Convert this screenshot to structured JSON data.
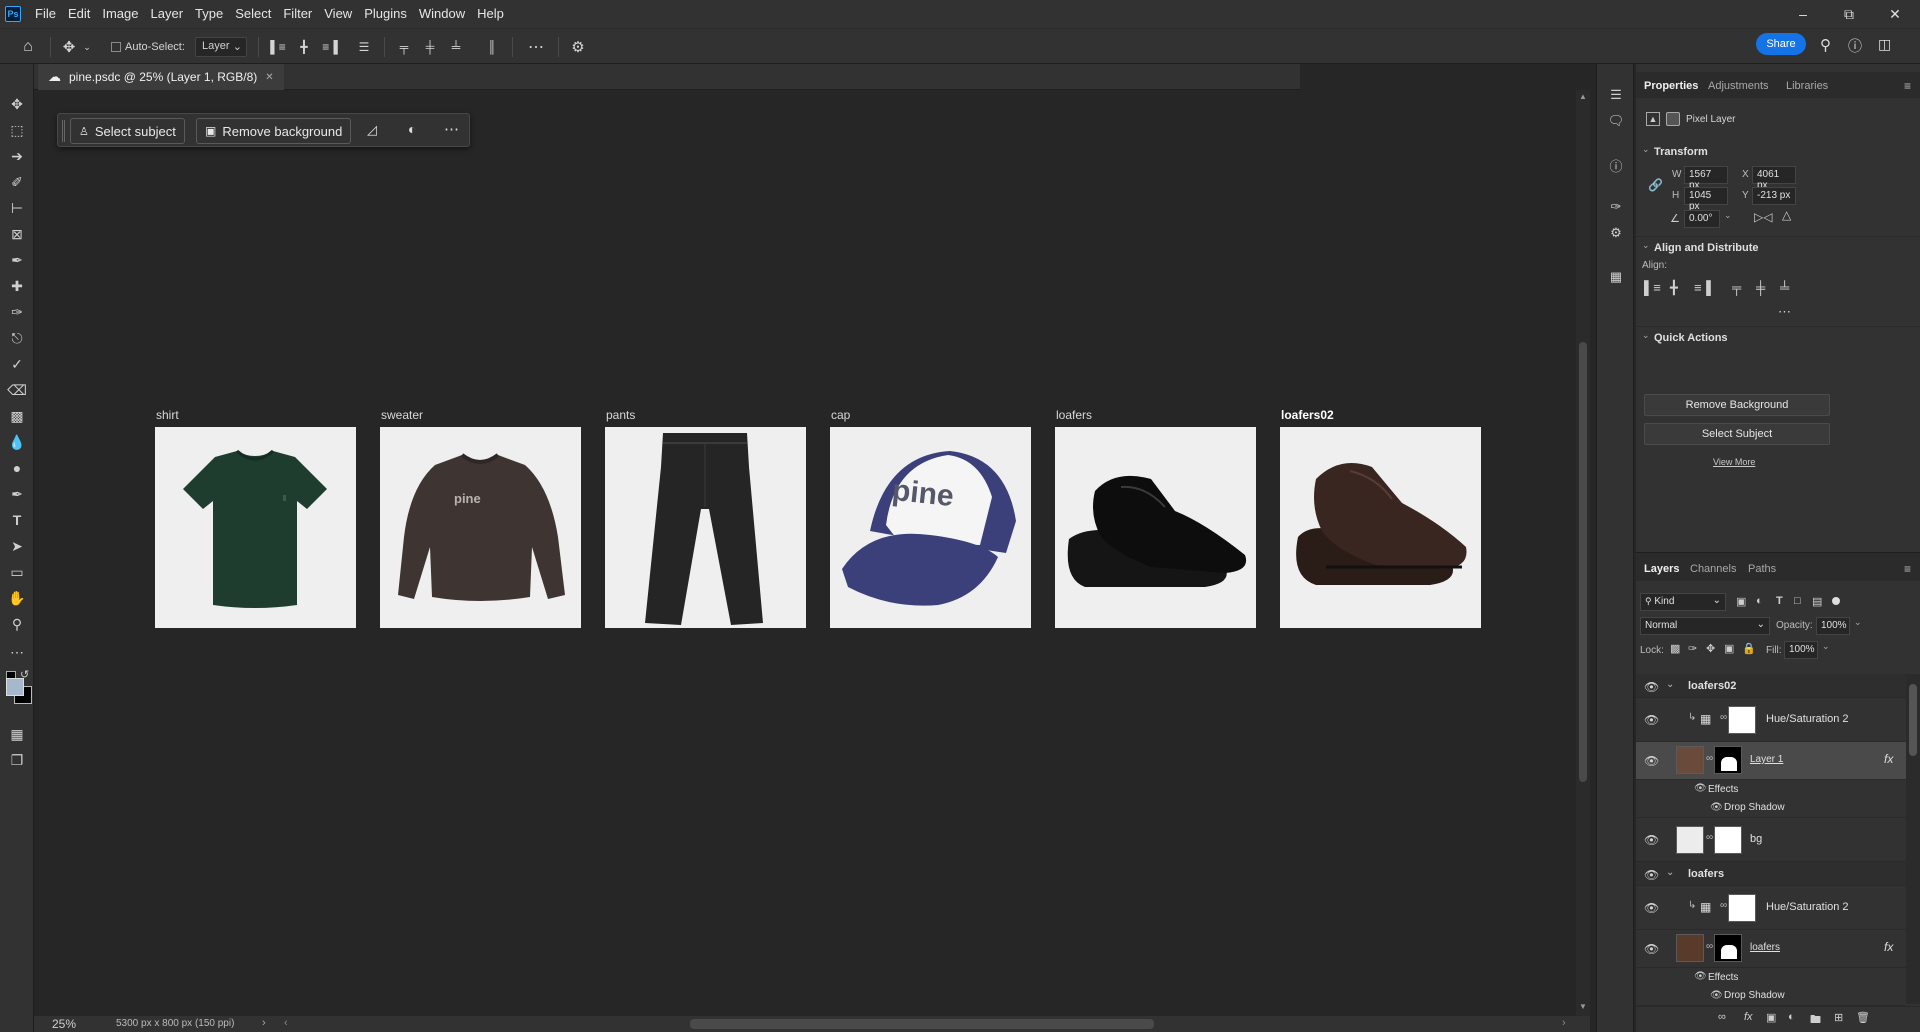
{
  "app": {
    "logo": "Ps",
    "menu": [
      "File",
      "Edit",
      "Image",
      "Layer",
      "Type",
      "Select",
      "Filter",
      "View",
      "Plugins",
      "Window",
      "Help"
    ]
  },
  "options_bar": {
    "auto_select_label": "Auto-Select:",
    "layer_dropdown": "Layer",
    "share_label": "Share"
  },
  "document": {
    "tab_title": "pine.psdc @ 25% (Layer 1, RGB/8)",
    "zoom": "25%",
    "doc_info": "5300 px x 800 px (150 ppi)"
  },
  "contextual_taskbar": {
    "select_subject": "Select subject",
    "remove_background": "Remove background"
  },
  "artboards": [
    {
      "label": "shirt",
      "bold": false
    },
    {
      "label": "sweater",
      "bold": false
    },
    {
      "label": "pants",
      "bold": false
    },
    {
      "label": "cap",
      "bold": false
    },
    {
      "label": "loafers",
      "bold": false
    },
    {
      "label": "loafers02",
      "bold": true
    }
  ],
  "product_texts": {
    "sweater_print": "pine",
    "cap_print": "pine"
  },
  "properties": {
    "tabs": [
      "Properties",
      "Adjustments",
      "Libraries"
    ],
    "layer_type": "Pixel Layer",
    "transform_title": "Transform",
    "w_label": "W",
    "w_value": "1567 px",
    "h_label": "H",
    "h_value": "1045 px",
    "x_label": "X",
    "x_value": "4061 px",
    "y_label": "Y",
    "y_value": "-213 px",
    "angle_value": "0.00°",
    "align_title": "Align and Distribute",
    "align_label": "Align:",
    "quick_actions_title": "Quick Actions",
    "remove_bg_btn": "Remove Background",
    "select_subject_btn": "Select Subject",
    "view_more": "View More"
  },
  "layers": {
    "tabs": [
      "Layers",
      "Channels",
      "Paths"
    ],
    "kind_label": "Kind",
    "blend_mode": "Normal",
    "opacity_label": "Opacity:",
    "opacity_value": "100%",
    "lock_label": "Lock:",
    "fill_label": "Fill:",
    "fill_value": "100%",
    "rows": {
      "group1": "loafers02",
      "hue1": "Hue/Saturation 2",
      "layer1": "Layer 1",
      "effects1": "Effects",
      "shadow1": "Drop Shadow",
      "bg": "bg",
      "group2": "loafers",
      "hue2": "Hue/Saturation 2",
      "loafers": "loafers",
      "effects2": "Effects",
      "shadow2": "Drop Shadow"
    }
  },
  "colors": {
    "accent": "#1473e6",
    "shirt": "#1e3d2e",
    "sweater": "#3e3533",
    "cap_brim": "#3b3f7a"
  }
}
